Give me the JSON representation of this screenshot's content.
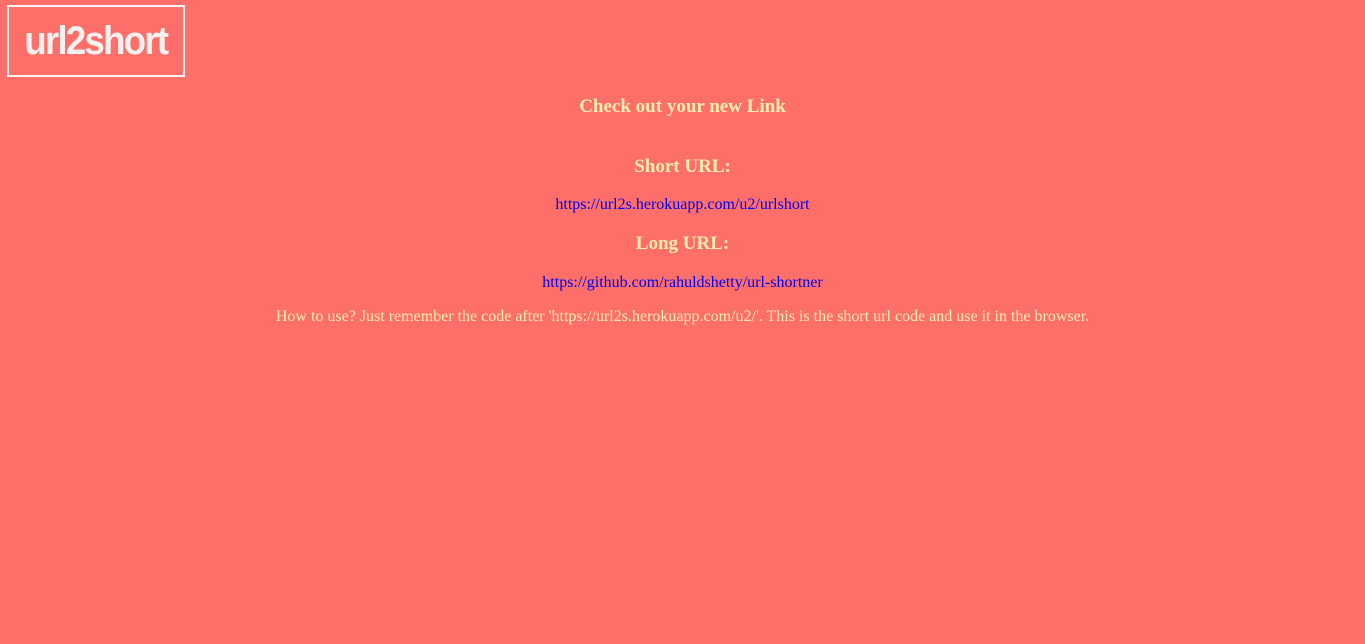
{
  "header": {
    "logo_text": "url2short"
  },
  "result": {
    "title": "Check out your new Link",
    "short_label": "Short URL:",
    "short_url": "https://url2s.herokuapp.com/u2/urlshort",
    "long_label": "Long URL:",
    "long_url": "https://github.com/rahuldshetty/url-shortner",
    "howto_text": "How to use? Just remember the code after 'https://url2s.herokuapp.com/u2/'. This is the short url code and use it in the browser."
  },
  "colors": {
    "background": "#ff6f69",
    "heading": "#ffeead",
    "link": "#0000ee",
    "logo": "#f7f0f0"
  }
}
